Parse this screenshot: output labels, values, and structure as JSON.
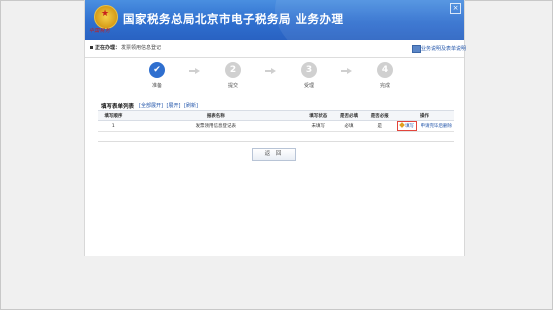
{
  "header": {
    "emblem_text": "中国税务",
    "title": "国家税务总局北京市电子税务局  业务办理"
  },
  "crumb": {
    "label": "正在办理：",
    "value": "发票领用信息登记",
    "help_link": "业务说明及表单说明"
  },
  "steps": [
    {
      "number": "✔",
      "label": "准备"
    },
    {
      "number": "2",
      "label": "提交"
    },
    {
      "number": "3",
      "label": "受理"
    },
    {
      "number": "4",
      "label": "完成"
    }
  ],
  "list": {
    "title": "填写表单列表",
    "links": [
      "[全部展开]",
      "[展开]",
      "[刷新]"
    ]
  },
  "table": {
    "headers": [
      "填写顺序",
      "报表名称",
      "填写状态",
      "是否必填",
      "是否必报",
      "操作"
    ],
    "rows": [
      {
        "seq": "1",
        "name": "发票领用信息登记表",
        "status": "未填写",
        "required_fill": "必填",
        "required_submit": "是",
        "fill_label": "填写",
        "delete_label": "申请完毕后删除"
      }
    ]
  },
  "buttons": {
    "back": "返 回"
  },
  "colors": {
    "banner": "#2f6fcf",
    "step_active": "#2f6fcf",
    "step_inactive": "#d0d0d0",
    "link": "#2255aa",
    "highlight_border": "#e2453c"
  }
}
